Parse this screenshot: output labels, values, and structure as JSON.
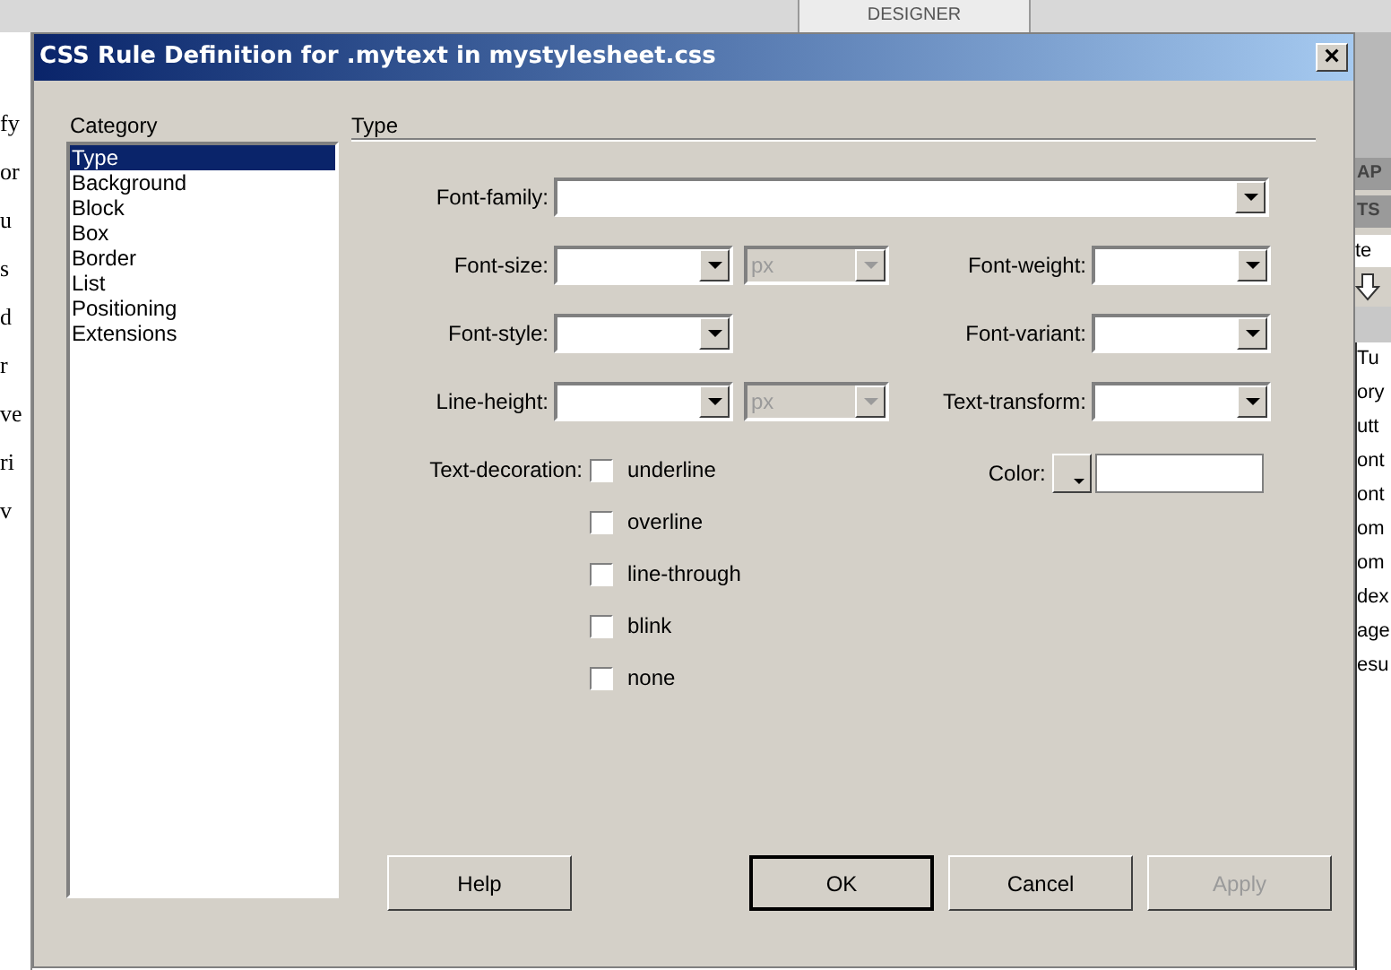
{
  "background_app": {
    "tab": "DESIGNER",
    "left_fragments": [
      "fy",
      "or",
      "u",
      "s",
      "d",
      "r",
      "ve",
      "ri",
      "v"
    ],
    "right_tabs": [
      "AP",
      "TS"
    ],
    "right_field": "te",
    "right_list": [
      "Tu",
      "ory",
      "utt",
      "ont",
      "ont",
      "om",
      "om",
      "dex",
      "age",
      "esu"
    ]
  },
  "window": {
    "title": "CSS Rule Definition for .mytext in mystylesheet.css",
    "close": "×"
  },
  "category": {
    "label": "Category",
    "items": [
      {
        "label": "Type",
        "selected": true
      },
      {
        "label": "Background",
        "selected": false
      },
      {
        "label": "Block",
        "selected": false
      },
      {
        "label": "Box",
        "selected": false
      },
      {
        "label": "Border",
        "selected": false
      },
      {
        "label": "List",
        "selected": false
      },
      {
        "label": "Positioning",
        "selected": false
      },
      {
        "label": "Extensions",
        "selected": false
      }
    ]
  },
  "panel": {
    "title": "Type",
    "font_family": {
      "label": "Font-family:"
    },
    "rows": [
      {
        "left": {
          "label": "Font-size:",
          "unit": "px",
          "unit_disabled": true
        },
        "right": {
          "label": "Font-weight:"
        }
      },
      {
        "left": {
          "label": "Font-style:"
        },
        "right": {
          "label": "Font-variant:"
        }
      },
      {
        "left": {
          "label": "Line-height:",
          "unit": "px",
          "unit_disabled": true
        },
        "right": {
          "label": "Text-transform:"
        }
      }
    ],
    "decoration": {
      "label": "Text-decoration:",
      "options": [
        {
          "label": "underline",
          "checked": false
        },
        {
          "label": "overline",
          "checked": false
        },
        {
          "label": "line-through",
          "checked": false
        },
        {
          "label": "blink",
          "checked": false
        },
        {
          "label": "none",
          "checked": false
        }
      ]
    },
    "color": {
      "label": "Color:"
    }
  },
  "buttons": [
    {
      "label": "Help",
      "default": false,
      "disabled": false
    },
    {
      "label": "OK",
      "default": true,
      "disabled": false
    },
    {
      "label": "Cancel",
      "default": false,
      "disabled": false
    },
    {
      "label": "Apply",
      "default": false,
      "disabled": true
    }
  ]
}
